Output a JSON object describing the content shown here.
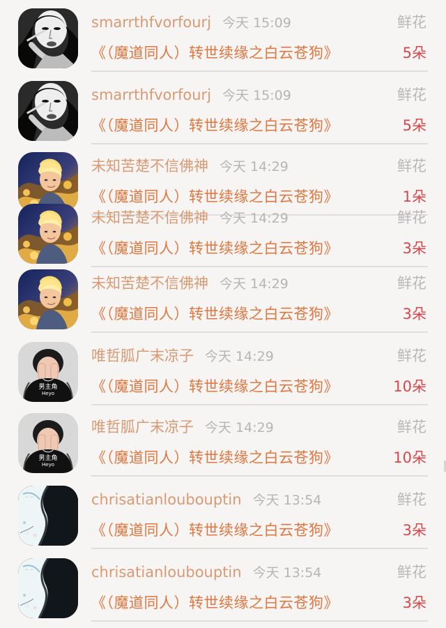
{
  "feed": {
    "items": [
      {
        "user": "smarrthfvorfourj",
        "time": "今天 15:09",
        "gift": "鲜花",
        "book": "《（魔道同人）转世续缘之白云苍狗》",
        "count": "5朵",
        "avatar_icon": "avatar-woman-smoking-icon"
      },
      {
        "user": "smarrthfvorfourj",
        "time": "今天 15:09",
        "gift": "鲜花",
        "book": "《（魔道同人）转世续缘之白云苍狗》",
        "count": "5朵",
        "avatar_icon": "avatar-woman-smoking-icon"
      },
      {
        "user": "未知苦楚不信佛神",
        "time": "今天 14:29",
        "gift": "鲜花",
        "book": "《（魔道同人）转世续缘之白云苍狗》",
        "count": "1朵",
        "avatar_icon": "avatar-anime-blonde-icon"
      },
      {
        "user": "未知苦楚不信佛神",
        "time": "今天 14:29",
        "gift": "鲜花",
        "book": "《（魔道同人）转世续缘之白云苍狗》",
        "count": "3朵",
        "avatar_icon": "avatar-anime-blonde-icon"
      },
      {
        "user": "未知苦楚不信佛神",
        "time": "今天 14:29",
        "gift": "鲜花",
        "book": "《（魔道同人）转世续缘之白云苍狗》",
        "count": "3朵",
        "avatar_icon": "avatar-anime-blonde-icon"
      },
      {
        "user": "唯哲胍广末凉子",
        "time": "今天 14:29",
        "gift": "鲜花",
        "book": "《（魔道同人）转世续缘之白云苍狗》",
        "count": "10朵",
        "avatar_icon": "avatar-boy-hoodie-icon",
        "avatar_text": "男主角",
        "avatar_subtext": "Heyo"
      },
      {
        "user": "唯哲胍广末凉子",
        "time": "今天 14:29",
        "gift": "鲜花",
        "book": "《（魔道同人）转世续缘之白云苍狗》",
        "count": "10朵",
        "avatar_icon": "avatar-boy-hoodie-icon",
        "avatar_text": "男主角",
        "avatar_subtext": "Heyo"
      },
      {
        "user": "chrisatianloubouptin",
        "time": "今天 13:54",
        "gift": "鲜花",
        "book": "《（魔道同人）转世续缘之白云苍狗》",
        "count": "3朵",
        "avatar_icon": "avatar-ink-vase-icon"
      },
      {
        "user": "chrisatianloubouptin",
        "time": "今天 13:54",
        "gift": "鲜花",
        "book": "《（魔道同人）转世续缘之白云苍狗》",
        "count": "3朵",
        "avatar_icon": "avatar-ink-vase-icon"
      }
    ]
  },
  "colors": {
    "background": "#f7f4f4",
    "username": "#d89a73",
    "time": "#b5b5b5",
    "gift": "#b8b8b8",
    "book": "#e0773f",
    "count": "#d8474a",
    "divider": "#dedede"
  }
}
